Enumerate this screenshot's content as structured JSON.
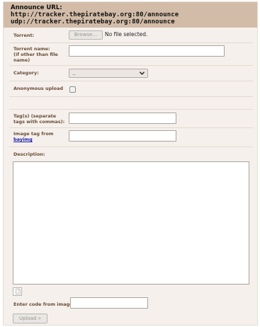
{
  "header": {
    "title": "Announce URL:",
    "urls": [
      "http://tracker.thepiratebay.org:80/announce",
      "udp://tracker.thepiratebay.org:80/announce"
    ]
  },
  "form": {
    "torrent_label": "Torrent:",
    "browse_label": "Browse...",
    "file_status": "No file selected.",
    "torrent_name_label": "Torrent name:",
    "torrent_name_hint_1": "(if other than file",
    "torrent_name_hint_2": "name)",
    "torrent_name_value": "",
    "category_label": "Category:",
    "category_selected": "..",
    "anonymous_label": "Anonymous upload",
    "anonymous_checked": false,
    "tags_label_1": "Tag(s) (separate",
    "tags_label_2": "tags with commas):",
    "tags_value": "",
    "image_tag_label": "Image tag from",
    "image_tag_link": "bayimg",
    "image_tag_value": "",
    "description_label": "Description:",
    "description_value": "",
    "captcha_label": "Enter code from image:",
    "captcha_value": "",
    "upload_label": "Upload »"
  }
}
